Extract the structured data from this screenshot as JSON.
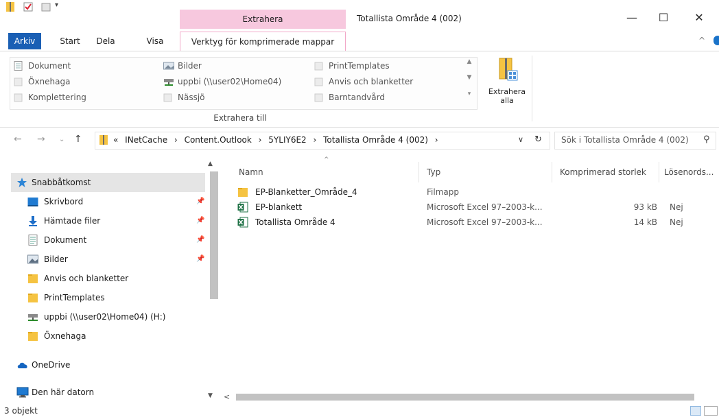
{
  "window": {
    "title": "Totallista  Område 4 (002)",
    "context_tab": "Extrahera",
    "minimize": "—",
    "maximize": "☐",
    "close": "✕"
  },
  "ribbon_tabs": [
    "Arkiv",
    "Start",
    "Dela",
    "Visa",
    "Verktyg för komprimerade mappar"
  ],
  "ribbon": {
    "gallery_items": [
      [
        "Dokument",
        "Bilder",
        "PrintTemplates"
      ],
      [
        "Öxnehaga",
        "uppbi (\\\\user02\\Home04)",
        "Anvis och blanketter"
      ],
      [
        "Komplettering",
        "Nässjö",
        "Barntandvård"
      ]
    ],
    "extract_all_line1": "Extrahera",
    "extract_all_line2": "alla",
    "group_label": "Extrahera till"
  },
  "address": {
    "prefix": "«",
    "path": [
      "INetCache",
      "Content.Outlook",
      "5YLIY6E2",
      "Totallista  Område 4 (002)"
    ],
    "separator": "›",
    "search_placeholder": "Sök i Totallista  Område 4 (002)"
  },
  "nav": {
    "items": [
      {
        "label": "Snabbåtkomst",
        "icon": "star-icon",
        "pinned": false,
        "selected": true
      },
      {
        "label": "Skrivbord",
        "icon": "desktop-icon",
        "pinned": true
      },
      {
        "label": "Hämtade filer",
        "icon": "download-icon",
        "pinned": true
      },
      {
        "label": "Dokument",
        "icon": "document-icon",
        "pinned": true
      },
      {
        "label": "Bilder",
        "icon": "pictures-icon",
        "pinned": true
      },
      {
        "label": "Anvis och blanketter",
        "icon": "folder-icon",
        "pinned": false
      },
      {
        "label": "PrintTemplates",
        "icon": "folder-icon",
        "pinned": false
      },
      {
        "label": "uppbi (\\\\user02\\Home04) (H:)",
        "icon": "network-drive-icon",
        "pinned": false
      },
      {
        "label": "Öxnehaga",
        "icon": "folder-icon",
        "pinned": false
      },
      {
        "label": "OneDrive",
        "icon": "cloud-icon",
        "pinned": false
      },
      {
        "label": "Den här datorn",
        "icon": "computer-icon",
        "pinned": false
      }
    ]
  },
  "columns": [
    "Namn",
    "Typ",
    "Komprimerad storlek",
    "Lösenords..."
  ],
  "files": [
    {
      "name": "EP-Blanketter_Område_4",
      "type": "Filmapp",
      "size": "",
      "password": "",
      "icon": "folder-icon"
    },
    {
      "name": "EP-blankett",
      "type": "Microsoft Excel 97–2003-k...",
      "size": "93 kB",
      "password": "Nej",
      "icon": "excel-icon"
    },
    {
      "name": "Totallista  Område 4",
      "type": "Microsoft Excel 97–2003-k...",
      "size": "14 kB",
      "password": "Nej",
      "icon": "excel-icon"
    }
  ],
  "status": {
    "count": "3 objekt"
  },
  "colors": {
    "accent": "#1a5fb4",
    "context_tab": "#f7c8de",
    "folder": "#f5c342",
    "excel": "#1e7145"
  }
}
